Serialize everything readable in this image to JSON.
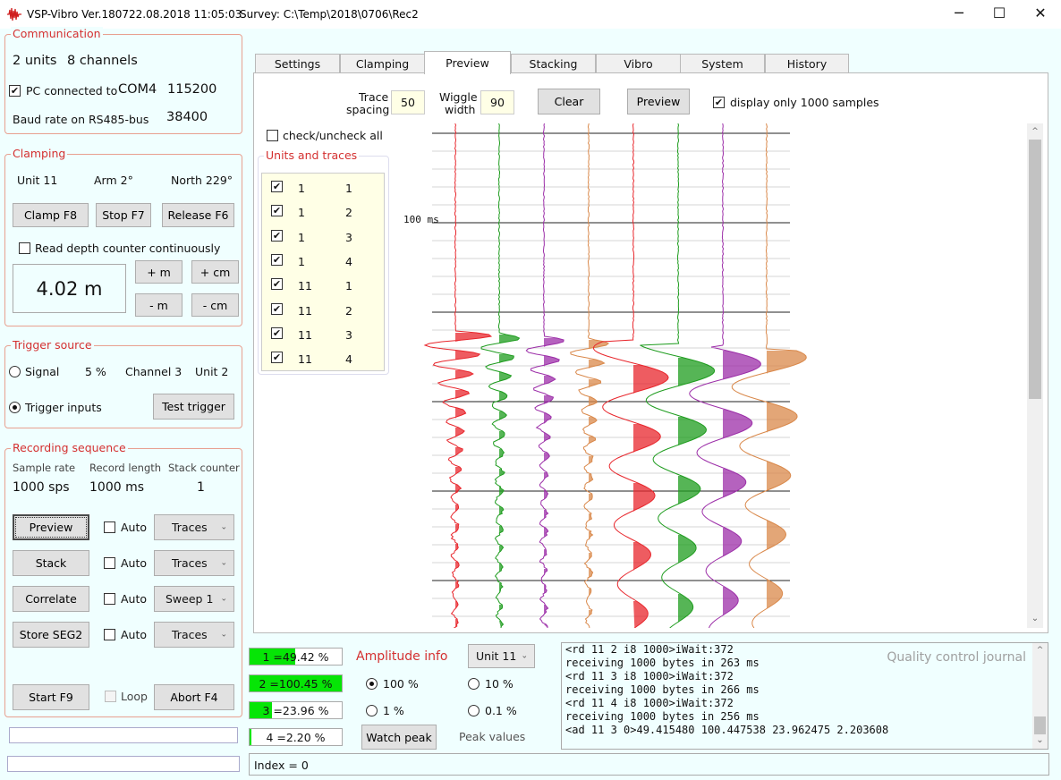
{
  "titlebar": {
    "app": "VSP-Vibro Ver.1807",
    "datetime": "22.08.2018 11:05:03",
    "survey": "Survey: C:\\Temp\\2018\\0706\\Rec2",
    "minimize": "─",
    "maximize": "☐",
    "close": "✕"
  },
  "communication": {
    "title": "Communication",
    "units": "2 units",
    "channels": "8 channels",
    "pc_connected_label": "PC connected to",
    "pc_connected_checked": true,
    "port": "COM4",
    "baud": "115200",
    "rs485_label": "Baud rate on RS485-bus",
    "rs485_value": "38400"
  },
  "clamping": {
    "title": "Clamping",
    "unit": "Unit 11",
    "arm": "Arm 2°",
    "north": "North 229°",
    "clamp_btn": "Clamp   F8",
    "stop_btn": "Stop    F7",
    "release_btn": "Release   F6",
    "read_depth_label": "Read depth counter continuously",
    "read_depth_checked": false,
    "depth": "4.02 m",
    "plus_m": "+ m",
    "plus_cm": "+ cm",
    "minus_m": "- m",
    "minus_cm": "- cm"
  },
  "trigger": {
    "title": "Trigger source",
    "signal_label": "Signal",
    "signal_pct": "5 %",
    "channel": "Channel 3",
    "unit": "Unit 2",
    "inputs_label": "Trigger inputs",
    "test_btn": "Test trigger",
    "selected": "inputs"
  },
  "recording": {
    "title": "Recording sequence",
    "sample_rate_label": "Sample rate",
    "record_length_label": "Record length",
    "stack_counter_label": "Stack counter",
    "sample_rate": "1000 sps",
    "record_length": "1000 ms",
    "stack_counter": "1",
    "rows": [
      {
        "button": "Preview",
        "auto": "Auto",
        "combo": "Traces"
      },
      {
        "button": "Stack",
        "auto": "Auto",
        "combo": "Traces"
      },
      {
        "button": "Correlate",
        "auto": "Auto",
        "combo": "Sweep 1"
      },
      {
        "button": "Store SEG2",
        "auto": "Auto",
        "combo": "Traces"
      }
    ],
    "start_btn": "Start     F9",
    "loop_label": "Loop",
    "abort_btn": "Abort    F4"
  },
  "tabs": [
    "Settings",
    "Clamping",
    "Preview",
    "Stacking",
    "Vibro",
    "System",
    "History"
  ],
  "active_tab": "Preview",
  "preview": {
    "trace_spacing_label_1": "Trace",
    "trace_spacing_label_2": "spacing",
    "trace_spacing": "50",
    "wiggle_label_1": "Wiggle",
    "wiggle_label_2": "width",
    "wiggle_width": "90",
    "clear_btn": "Clear",
    "preview_btn": "Preview",
    "display_only_label": "display only 1000 samples",
    "display_only_checked": true,
    "check_all_label": "check/uncheck all",
    "units_traces_title": "Units and traces",
    "traces": [
      {
        "unit": "1",
        "trace": "1"
      },
      {
        "unit": "1",
        "trace": "2"
      },
      {
        "unit": "1",
        "trace": "3"
      },
      {
        "unit": "1",
        "trace": "4"
      },
      {
        "unit": "11",
        "trace": "1"
      },
      {
        "unit": "11",
        "trace": "2"
      },
      {
        "unit": "11",
        "trace": "3"
      },
      {
        "unit": "11",
        "trace": "4"
      }
    ],
    "time_label": "100 ms",
    "trace_colors": [
      "#e8262c",
      "#1e9c1e",
      "#9c2ea8",
      "#d9884a",
      "#e8262c",
      "#1e9c1e",
      "#9c2ea8",
      "#d9884a"
    ]
  },
  "amplitude": {
    "bars": [
      {
        "text": "1 =49.42 %",
        "fill": 0.4942
      },
      {
        "text": "2 =100.45 %",
        "fill": 1.0
      },
      {
        "text": "3 =23.96 %",
        "fill": 0.2396
      },
      {
        "text": "4 =2.20 %",
        "fill": 0.022
      }
    ],
    "title": "Amplitude info",
    "unit_combo": "Unit 11",
    "opt_100": "100 %",
    "opt_10": "10 %",
    "opt_1": "1 %",
    "opt_01": "0.1 %",
    "selected": "100 %",
    "watch_peak_btn": "Watch peak",
    "peak_values_label": "Peak values"
  },
  "journal": {
    "title": "Quality control journal",
    "lines": [
      "<rd 11 2 i8 1000>iWait:372",
      "receiving 1000 bytes in 263 ms",
      "<rd 11 3 i8 1000>iWait:372",
      "receiving 1000 bytes in 266 ms",
      "<rd 11 4 i8 1000>iWait:372",
      "receiving 1000 bytes in 256 ms",
      "<ad 11 3 0>49.415480 100.447538 23.962475 2.203608"
    ]
  },
  "status": {
    "index": "Index = 0"
  }
}
